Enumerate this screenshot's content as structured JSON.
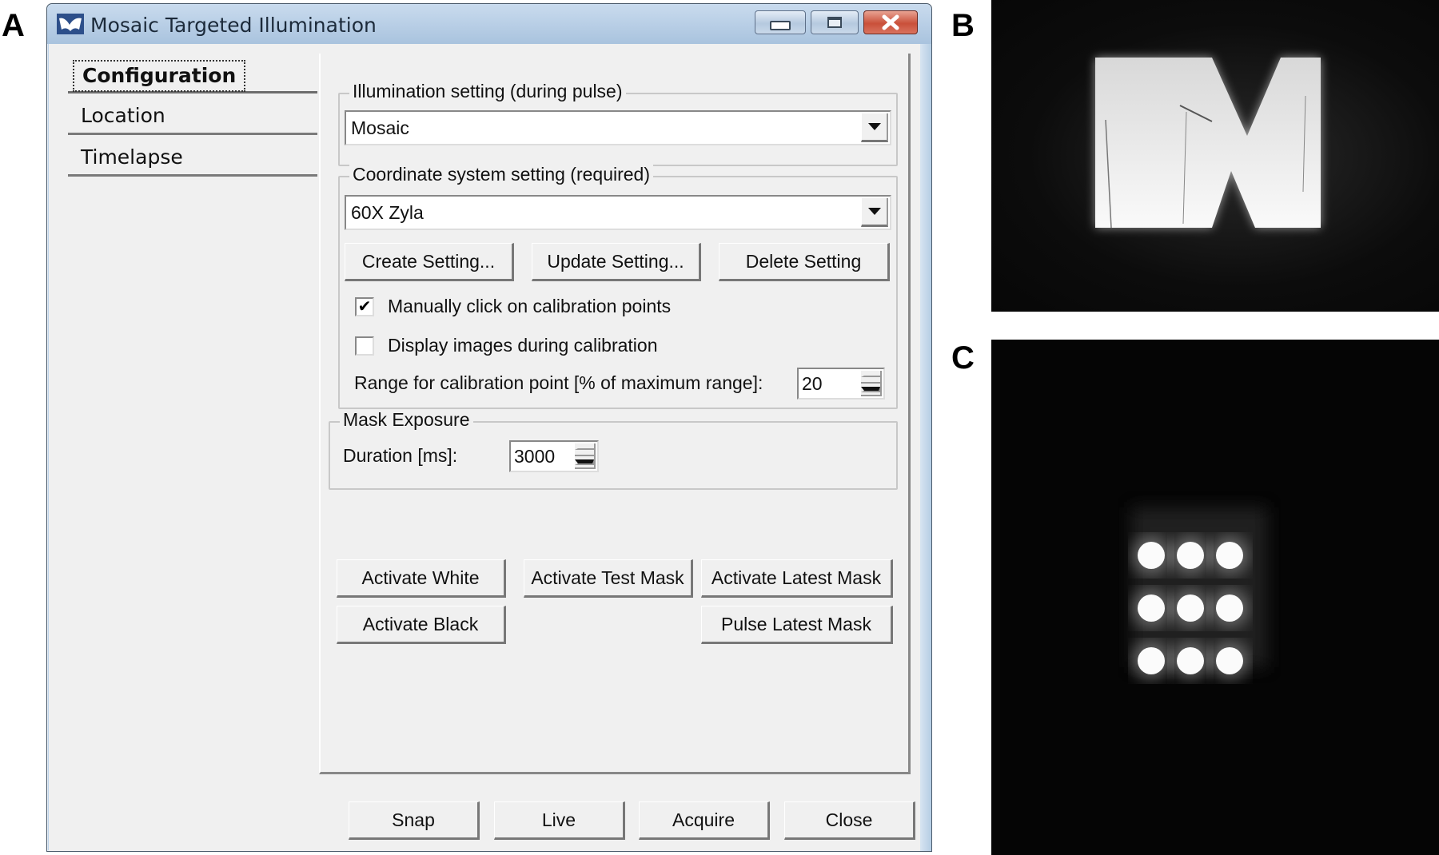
{
  "figure_panels": {
    "a": "A",
    "b": "B",
    "c": "C"
  },
  "window": {
    "title": "Mosaic Targeted Illumination",
    "app_icon": "app-logo-icon",
    "controls": {
      "minimize": "minimize-icon",
      "maximize": "maximize-icon",
      "close": "close-icon"
    }
  },
  "tabs": [
    {
      "label": "Configuration",
      "active": true
    },
    {
      "label": "Location",
      "active": false
    },
    {
      "label": "Timelapse",
      "active": false
    }
  ],
  "illumination": {
    "group_label": "Illumination setting (during pulse)",
    "selected": "Mosaic"
  },
  "coordinate": {
    "group_label": "Coordinate system setting (required)",
    "selected": "60X Zyla",
    "buttons": {
      "create": "Create Setting...",
      "update": "Update Setting...",
      "delete": "Delete Setting"
    },
    "manual_click": {
      "label": "Manually click on calibration points",
      "checked": true
    },
    "display_images": {
      "label": "Display images during calibration",
      "checked": false
    },
    "range_label": "Range for calibration point [% of maximum range]:",
    "range_value": "20"
  },
  "mask_exposure": {
    "group_label": "Mask Exposure",
    "duration_label": "Duration [ms]:",
    "duration_value": "3000"
  },
  "actions": {
    "activate_white": "Activate White",
    "activate_test_mask": "Activate Test Mask",
    "activate_latest_mask": "Activate Latest Mask",
    "activate_black": "Activate Black",
    "pulse_latest_mask": "Pulse Latest Mask"
  },
  "footer": {
    "snap": "Snap",
    "live": "Live",
    "acquire": "Acquire",
    "close": "Close"
  },
  "images": {
    "b": {
      "content": "Projected letter M illumination pattern"
    },
    "c": {
      "content": "3x3 grid of illuminated spots",
      "rows": 3,
      "cols": 3
    }
  },
  "colors": {
    "window_bg": "#f0f0f0",
    "titlebar": "#b9cfe6",
    "close_button": "#c9503a",
    "image_bg": "#070707"
  }
}
